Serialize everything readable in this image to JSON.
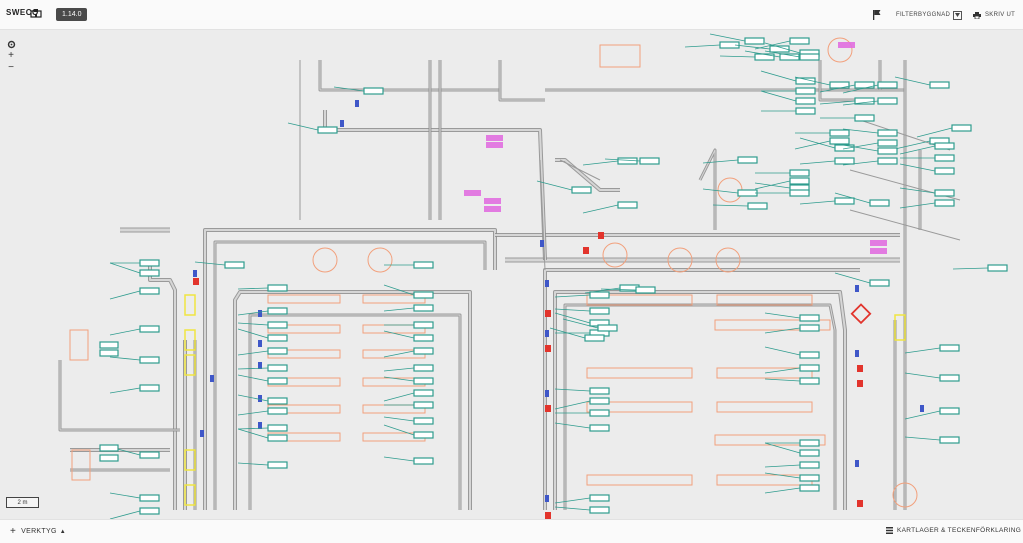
{
  "app": {
    "brand": "SWECO",
    "version": "1.14.0"
  },
  "toolbar": {
    "filter_label": "FILTERBYGGNAD",
    "print_label": "SKRIV UT"
  },
  "map": {
    "scale_label": "2 m",
    "zoom_in_label": "+",
    "zoom_out_label": "−"
  },
  "bottom": {
    "tools_label": "VERKTYG",
    "layers_label": "KARTLAGER & TECKENFÖRKLARING"
  },
  "icons": {
    "brand": "building-icon",
    "flag": "flag-icon",
    "print": "printer-icon",
    "settings": "gear-icon",
    "layers": "layers-icon",
    "tools": "plus-icon"
  },
  "colors": {
    "pipe": "#8c8c8c",
    "label": "#2f9c8e",
    "highlight": "#e16fe0",
    "room": "#f2a07c",
    "valve_red": "#e2342c",
    "device_blue": "#3f57c8",
    "device_yellow": "#f0e542"
  }
}
